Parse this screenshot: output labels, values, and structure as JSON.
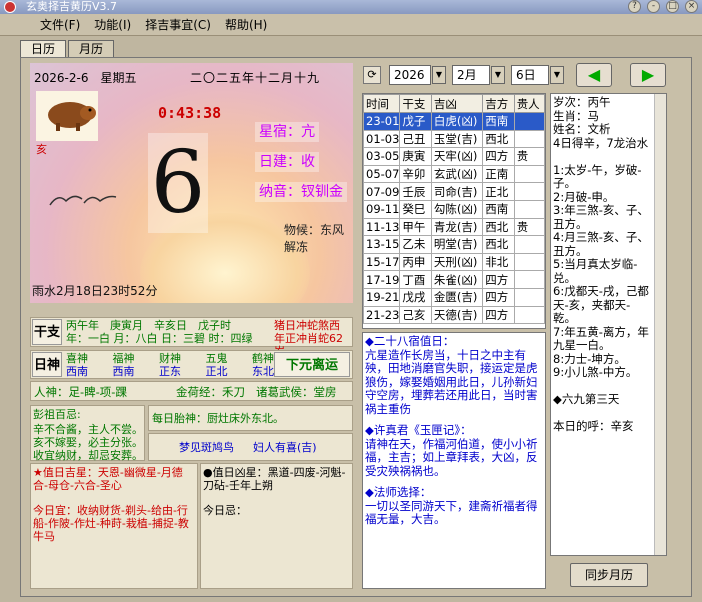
{
  "window": {
    "title": "玄奥择吉黄历V3.7"
  },
  "menu": [
    "文件(F)",
    "功能(I)",
    "择吉事宜(C)",
    "帮助(H)"
  ],
  "tabs": [
    "日历",
    "月历"
  ],
  "day": {
    "date": "2026-2-6",
    "weekday": "星期五",
    "lunar": "二〇二五年十二月十九",
    "time": "0:43:38",
    "day_number": "6",
    "xingxiu": "星宿：亢",
    "jianchu": "日建：收",
    "nayin": "纳音：钗钏金",
    "wuhou": "物候：东风解冻",
    "jieqi": "雨水2月18日23时52分",
    "zodiac": "亥"
  },
  "ganzhi": {
    "label": "干支",
    "line1": "丙午年　庚寅月　辛亥日　戊子时",
    "line2": "年：一白 月：八白 日：三碧 时：四绿",
    "chong1": "猪日冲蛇煞西",
    "chong2": "年正冲肖蛇62岁"
  },
  "shen": {
    "label": "日神",
    "row1": [
      "喜神",
      "福神",
      "财神",
      "五鬼",
      "鹤神"
    ],
    "row2": [
      "西南",
      "西南",
      "正东",
      "正北",
      "东北"
    ],
    "yuan": "下元离运"
  },
  "renshen": {
    "text": "人神：足-睥-项-踝",
    "jinqi": "金荷经：禾刀",
    "zhuge": "诸葛武侯：堂房"
  },
  "pengzu": {
    "title": "彭祖百忌:",
    "l1": "辛不合酱，主人不尝。",
    "l2": "亥不嫁娶，必主分张。",
    "l3": "收宜纳财，却忌安葬。"
  },
  "taishen": {
    "text": "每日胎神：厨灶床外东北。",
    "dream": "梦见斑鸠鸟",
    "dream2": "妇人有喜(吉)"
  },
  "jixing": {
    "title": "★值日吉星：天恩-幽微星-月德合-母仓-六合-圣心",
    "yi": "今日宜：收纳财货-剃头-给由-行船-作陂-作灶-种莳-栽植-捕捉-教牛马"
  },
  "xiongxing": {
    "title": "●值日凶星：黑道-四废-河魁-刀砧-壬年上朔",
    "ji": "今日忌："
  },
  "controls": {
    "year": "2026",
    "month": "2月",
    "day": "6日"
  },
  "hours": {
    "headers": [
      "时间",
      "干支",
      "吉凶",
      "吉方",
      "贵人"
    ],
    "rows": [
      [
        "23-01",
        "戊子",
        "白虎(凶)",
        "西南",
        ""
      ],
      [
        "01-03",
        "己丑",
        "玉堂(吉)",
        "西北",
        ""
      ],
      [
        "03-05",
        "庚寅",
        "天牢(凶)",
        "四方",
        "贵"
      ],
      [
        "05-07",
        "辛卯",
        "玄武(凶)",
        "正南",
        ""
      ],
      [
        "07-09",
        "壬辰",
        "司命(吉)",
        "正北",
        ""
      ],
      [
        "09-11",
        "癸巳",
        "勾陈(凶)",
        "西南",
        ""
      ],
      [
        "11-13",
        "甲午",
        "青龙(吉)",
        "西北",
        "贵"
      ],
      [
        "13-15",
        "乙未",
        "明堂(吉)",
        "西北",
        ""
      ],
      [
        "15-17",
        "丙申",
        "天刑(凶)",
        "非北",
        ""
      ],
      [
        "17-19",
        "丁酉",
        "朱雀(凶)",
        "四方",
        ""
      ],
      [
        "19-21",
        "戊戌",
        "金匮(吉)",
        "四方",
        ""
      ],
      [
        "21-23",
        "己亥",
        "天德(吉)",
        "四方",
        ""
      ]
    ]
  },
  "notes": {
    "l1": "◆二十八宿值日：",
    "l2": "亢星造作长房当，十日之中主有殃，田地消磨官失职，接运定是虎狼伤，嫁娶婚姻用此日，儿孙新妇守空房，埋葬若还用此日，当时害祸主重伤",
    "l3": "◆许真君《玉匣记》：",
    "l4": "请神在天，作福河伯道，使小小祈福，主吉；如上章拜表，大凶，反受灾殃祸祸也。",
    "l5": "◆法师选择：",
    "l6": "一切以圣同游天下，建斋祈福者得福无量，大吉。"
  },
  "side": {
    "lines": [
      "岁次：丙午",
      "生肖：马",
      "姓名：文析",
      "4日得辛，7龙治水",
      "",
      "1:太岁-午，岁破-子。",
      "2:月破-申。",
      "3:年三煞-亥、子、丑方。",
      "4:月三煞-亥、子、丑方。",
      "5:当月真太岁临-兑。",
      "6:戊都天-戌，己都天-亥，夹都天-乾。",
      "7:年五黄-离方，年九星一白。",
      "8:力士-坤方。",
      "9:小儿煞-中方。",
      "",
      "◆六九第三天",
      "",
      "本日的呼：辛亥"
    ],
    "button": "同步月历"
  }
}
